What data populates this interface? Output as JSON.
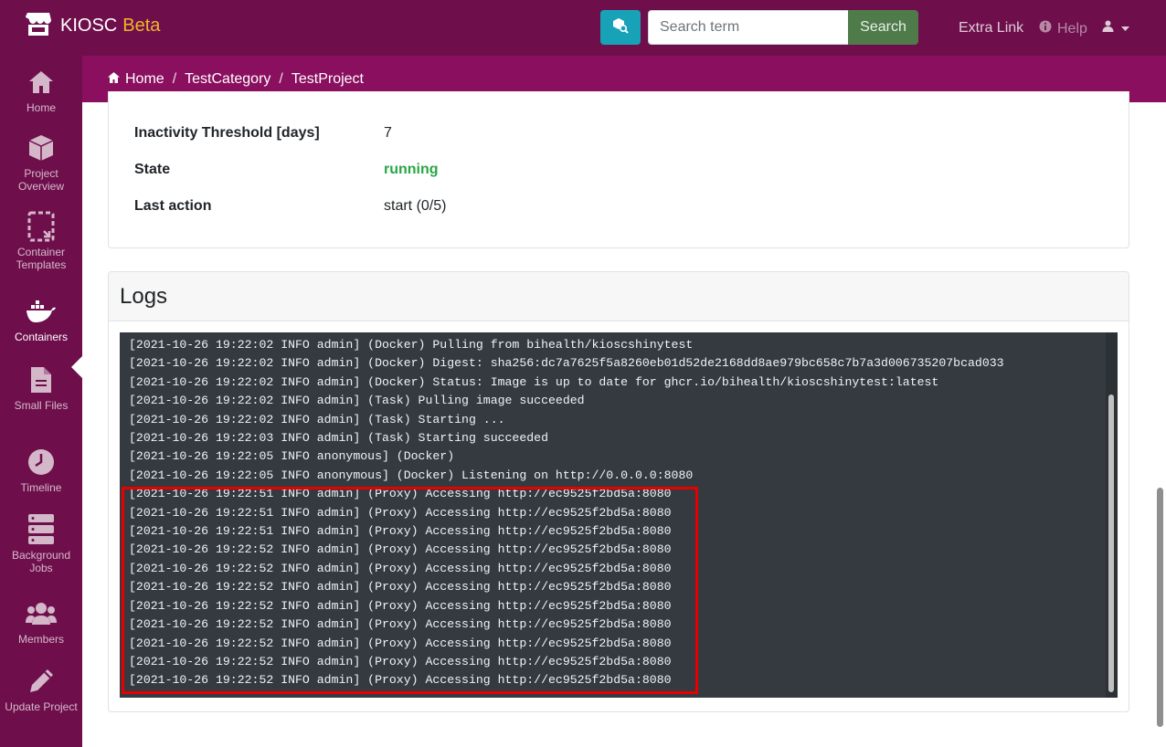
{
  "navbar": {
    "brand": "KIOSC",
    "brand_beta": "Beta",
    "search_placeholder": "Search term",
    "search_button": "Search",
    "extra_link": "Extra Link",
    "help": "Help"
  },
  "sidebar": {
    "items": [
      {
        "label": "Home",
        "icon": "home-icon"
      },
      {
        "label": "Project Overview",
        "icon": "cube-icon"
      },
      {
        "label": "Container Templates",
        "icon": "template-icon"
      },
      {
        "label": "Containers",
        "icon": "docker-icon",
        "active": true
      },
      {
        "label": "Small Files",
        "icon": "file-icon"
      },
      {
        "label": "Timeline",
        "icon": "clock-icon"
      },
      {
        "label": "Background Jobs",
        "icon": "server-icon"
      },
      {
        "label": "Members",
        "icon": "users-icon"
      },
      {
        "label": "Update Project",
        "icon": "pencil-icon"
      }
    ]
  },
  "breadcrumb": {
    "home": "Home",
    "category": "TestCategory",
    "project": "TestProject"
  },
  "details": {
    "rows": [
      {
        "label": "Inactivity Threshold [days]",
        "value": "7"
      },
      {
        "label": "State",
        "value": "running"
      },
      {
        "label": "Last action",
        "value": "start (0/5)"
      }
    ]
  },
  "logs": {
    "title": "Logs",
    "text": "[2021-10-26 19:22:02 INFO admin] (Docker) Pulling from bihealth/kioscshinytest\n[2021-10-26 19:22:02 INFO admin] (Docker) Digest: sha256:dc7a7625f5a8260eb01d52de2168dd8ae979bc658c7b7a3d006735207bcad033\n[2021-10-26 19:22:02 INFO admin] (Docker) Status: Image is up to date for ghcr.io/bihealth/kioscshinytest:latest\n[2021-10-26 19:22:02 INFO admin] (Task) Pulling image succeeded\n[2021-10-26 19:22:02 INFO admin] (Task) Starting ...\n[2021-10-26 19:22:03 INFO admin] (Task) Starting succeeded\n[2021-10-26 19:22:05 INFO anonymous] (Docker)\n[2021-10-26 19:22:05 INFO anonymous] (Docker) Listening on http://0.0.0.0:8080\n[2021-10-26 19:22:51 INFO admin] (Proxy) Accessing http://ec9525f2bd5a:8080\n[2021-10-26 19:22:51 INFO admin] (Proxy) Accessing http://ec9525f2bd5a:8080\n[2021-10-26 19:22:51 INFO admin] (Proxy) Accessing http://ec9525f2bd5a:8080\n[2021-10-26 19:22:52 INFO admin] (Proxy) Accessing http://ec9525f2bd5a:8080\n[2021-10-26 19:22:52 INFO admin] (Proxy) Accessing http://ec9525f2bd5a:8080\n[2021-10-26 19:22:52 INFO admin] (Proxy) Accessing http://ec9525f2bd5a:8080\n[2021-10-26 19:22:52 INFO admin] (Proxy) Accessing http://ec9525f2bd5a:8080\n[2021-10-26 19:22:52 INFO admin] (Proxy) Accessing http://ec9525f2bd5a:8080\n[2021-10-26 19:22:52 INFO admin] (Proxy) Accessing http://ec9525f2bd5a:8080\n[2021-10-26 19:22:52 INFO admin] (Proxy) Accessing http://ec9525f2bd5a:8080\n[2021-10-26 19:22:52 INFO admin] (Proxy) Accessing http://ec9525f2bd5a:8080"
  },
  "colors": {
    "navbar": "#6e0f4c",
    "breadcrumb": "#8a0f5f",
    "beta": "#f0b429",
    "running": "#28a745",
    "highlight": "#e60000"
  }
}
